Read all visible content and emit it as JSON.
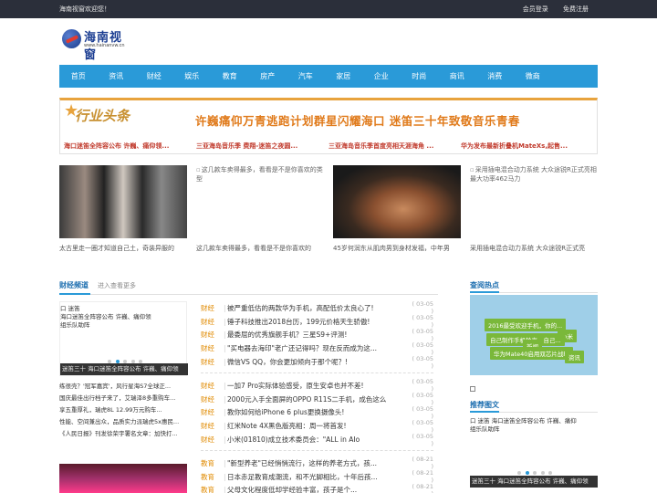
{
  "topbar": {
    "welcome": "海南视窗欢迎您！",
    "login": "会员登录",
    "register": "免费注册"
  },
  "logo": {
    "title": "海南视窗",
    "url": "www.hainanvw.cn"
  },
  "nav": [
    "首页",
    "资讯",
    "财经",
    "娱乐",
    "教育",
    "房产",
    "汽车",
    "家居",
    "企业",
    "时尚",
    "商讯",
    "消费",
    "微商"
  ],
  "banner": {
    "badge": "行业头条",
    "headline": "许巍痛仰万青逃跑计划群星闪耀海口 迷笛三十年致敬音乐青春",
    "subs": [
      "海口迷笛全阵容公布 许巍、痛仰领...",
      "三亚海岛音乐季 费翔-迷笛之夜圆...",
      "三亚海岛音乐季首度亮相天涯海角 ...",
      "华为发布最新折叠机MateXs,起售..."
    ]
  },
  "photos": [
    {
      "alt": "",
      "caption": "太古里走一圈才知道自己土，奇装异服的"
    },
    {
      "alt": "这几款车卖得最多，看看是不是你喜欢的类型",
      "caption": "这几款车卖得最多，看看是不是你喜欢的"
    },
    {
      "alt": "",
      "caption": "45岁何润东从肌肉男到身材发福，中年男"
    },
    {
      "alt": "采用插电混合动力系统 大众途锐R正式亮相 最大功率462马力",
      "caption": "采用插电混合动力系统 大众途锐R正式亮"
    }
  ],
  "finance": {
    "title": "财经频道",
    "more": "进入查看更多",
    "slider_text_lines": [
      "口 迷笛",
      "海口迷笛全阵容公布 许巍、痛仰领",
      "组乐队助阵"
    ],
    "slider_bar": "迷笛三十    海口迷笛全阵容公布 许巍、痛仰领",
    "left_list": [
      "练很壳？'冠军嘉宾'，风行星海S7全球正...",
      "国庆最佳出行档子来了，艾瑞泽8多重购车...",
      "享五重厚礼，瑞虎8L 12.99万元购车...",
      "性能、空间兼出众，品质实力派瑞虎5x惠民...",
      "《人民日报》刊发徐荣宇署名文章：加快打..."
    ],
    "groups": [
      [
        {
          "cat": "财经",
          "title": "被严重低估的两款华为手机，高配低价太良心了!",
          "date": "( 03-05 )"
        },
        {
          "cat": "财经",
          "title": "锤子科技推出2018台历，199元价格天生骄傲!",
          "date": "( 03-05 )"
        },
        {
          "cat": "财经",
          "title": "最委屈的优秀旗舰手机？三星S9+评测!",
          "date": "( 03-05 )"
        },
        {
          "cat": "财经",
          "title": "\"买电器去海印\"老广还记得吗？现在反而成为这...",
          "date": "( 03-05 )"
        },
        {
          "cat": "财经",
          "title": "微信VS QQ，你会更加倾向于那个呢？!",
          "date": "( 03-05 )"
        }
      ],
      [
        {
          "cat": "财经",
          "title": "一加7 Pro实际体验感受，原生安卓也并不差!",
          "date": "( 03-05 )"
        },
        {
          "cat": "财经",
          "title": "2000元入手全面屏的OPPO R11S二手机，成色这么",
          "date": "( 03-05 )"
        },
        {
          "cat": "财经",
          "title": "教你如何给iPhone 6 plus更换摄像头!",
          "date": "( 03-05 )"
        },
        {
          "cat": "财经",
          "title": "红米Note 4X黑色版亮相：周一将首发!",
          "date": "( 03-05 )"
        },
        {
          "cat": "财经",
          "title": "小米(01810)成立技术委员会：\"ALL in AIo",
          "date": "( 03-05 )"
        }
      ],
      [
        {
          "cat": "教育",
          "title": "\"新型养老\"已经悄悄流行，这样的养老方式，孩...",
          "date": "( 08-21 )"
        },
        {
          "cat": "教育",
          "title": "日本赤足教育成潮流，和不光脚相比，十年后孩...",
          "date": "( 08-21 )"
        },
        {
          "cat": "教育",
          "title": "父母文化程度低却学经验丰富，孩子是个...",
          "date": "( 08-21 )"
        }
      ]
    ]
  },
  "sidebar": {
    "hot_title": "查阅热点",
    "tags": [
      "2016最受欢迎手机，你的...",
      "小米",
      "自己制作手机铃声，自己...",
      "新闻",
      "华为Mate40启用双芯片战略",
      "资讯"
    ],
    "recommend_title": "推荐图文",
    "slider_text_lines": [
      "口 迷笛    海口迷笛全阵容公布 许巍、痛仰",
      "组乐队助阵"
    ],
    "slider_bar": "迷笛三十    海口迷笛全阵容公布 许巍、痛仰领"
  }
}
